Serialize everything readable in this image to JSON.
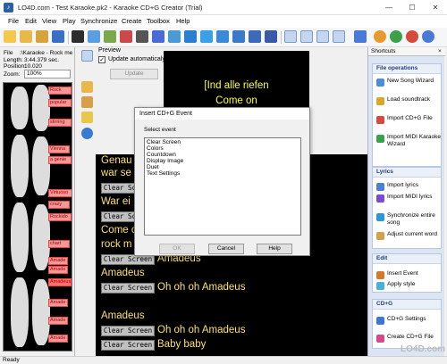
{
  "window": {
    "title": "LO4D.com - Test Karaoke.pk2 - Karaoke CD+G Creator (Trial)",
    "icon": "karaoke-app-icon"
  },
  "menu": [
    "File",
    "Edit",
    "View",
    "Play",
    "Synchronize",
    "Create",
    "Toolbox",
    "Help"
  ],
  "toolbar": {
    "buttons": [
      "new-icon",
      "open-icon",
      "save-icon",
      "lyrics-icon",
      "import-icon",
      "play-icon",
      "step-icon",
      "record-icon",
      "mic-icon",
      "music-note-icon",
      "repeat-icon",
      "sync-icon",
      "play-icon",
      "pause-icon",
      "stop-icon",
      "rewind-icon",
      "forward-icon",
      "cdg-icon",
      "cdg2-icon",
      "screen-icon",
      "screen2-icon",
      "spell-check-icon",
      "burn-icon",
      "help-icon",
      "refresh-icon"
    ]
  },
  "left_panel": {
    "file_label": "File",
    "file_value": ":\\Karaoke - Rock me am",
    "length_label": "Length:",
    "length_value": "3:44.379 sec.",
    "position_label": "Position:",
    "position_value": "10.020",
    "zoom_label": "Zoom:",
    "zoom_value": "100%",
    "markers": [
      "Rock",
      "popular",
      "stirring",
      "Vienna",
      "a genie",
      "Virtuoso",
      "crazy",
      "Rockido",
      "chart",
      "Amade",
      "Amade",
      "Amadeus",
      "Amade",
      "Amade",
      "Amade"
    ]
  },
  "preview": {
    "label": "Preview",
    "update_auto_label": "Update automaticaly",
    "update_auto_checked": true,
    "update_button": "Update",
    "screen_lines": [
      "[Ind alle riefen",
      "Come on"
    ]
  },
  "lyrics": {
    "command_label": "Clear Screen",
    "rows": [
      {
        "cmd": false,
        "text": "Genau"
      },
      {
        "cmd": false,
        "text": "war se"
      },
      {
        "cmd": true,
        "text": ""
      },
      {
        "cmd": false,
        "text": "War ei"
      },
      {
        "cmd": true,
        "text": ""
      },
      {
        "cmd": false,
        "text": "Come o"
      },
      {
        "cmd": false,
        "text": "rock m"
      },
      {
        "cmd": true,
        "text": "Amadeus"
      },
      {
        "cmd": false,
        "text": "Amadeus"
      },
      {
        "cmd": true,
        "text": "Oh oh oh Amadeus"
      },
      {
        "cmd": false,
        "text": "Amadeus"
      },
      {
        "cmd": true,
        "text": "Oh oh oh Amadeus"
      },
      {
        "cmd": true,
        "text": "Baby baby"
      }
    ]
  },
  "dialog": {
    "title": "Insert CD+G Event",
    "select_label": "Select event",
    "options": [
      "Clear Screen",
      "Colors",
      "Countdown",
      "Display Image",
      "Duet",
      "Text Settings"
    ],
    "ok": "OK",
    "cancel": "Cancel",
    "help": "Help"
  },
  "shortcuts": {
    "header": "Shortcuts",
    "close": "×",
    "sections": [
      {
        "title": "File operations",
        "items": [
          {
            "label": "New Song Wizard",
            "icon": "new-song-icon",
            "color": "#4a8fd6"
          },
          {
            "label": "Load soundtrack",
            "icon": "load-soundtrack-icon",
            "color": "#d9a72b"
          },
          {
            "label": "Import CD+G File",
            "icon": "import-cdg-icon",
            "color": "#d64a3a"
          },
          {
            "label": "Import MIDI Karaoke Wizard",
            "icon": "import-midi-icon",
            "color": "#3aa04a"
          }
        ]
      },
      {
        "title": "Lyrics",
        "items": [
          {
            "label": "Import lyrics",
            "icon": "import-lyrics-icon",
            "color": "#4a7fd6"
          },
          {
            "label": "Import MIDI lyrics",
            "icon": "import-midi-lyrics-icon",
            "color": "#7a4ad6"
          },
          {
            "label": "Synchronize entire song",
            "icon": "synchronize-icon",
            "color": "#2a9ad6"
          },
          {
            "label": "Adjust current word",
            "icon": "adjust-word-icon",
            "color": "#d6a04a"
          }
        ]
      },
      {
        "title": "Edit",
        "items": [
          {
            "label": "Insert Event",
            "icon": "insert-event-icon",
            "color": "#d67a2a"
          },
          {
            "label": "Apply style",
            "icon": "apply-style-icon",
            "color": "#4ab0d6"
          }
        ]
      },
      {
        "title": "CD+G",
        "items": [
          {
            "label": "CD+G Settings",
            "icon": "cdg-settings-icon",
            "color": "#3a7ad6"
          },
          {
            "label": "Create CD+G File",
            "icon": "create-cdg-icon",
            "color": "#d64a8a"
          }
        ]
      }
    ]
  },
  "status": "Ready",
  "watermark": "LO4D.com"
}
